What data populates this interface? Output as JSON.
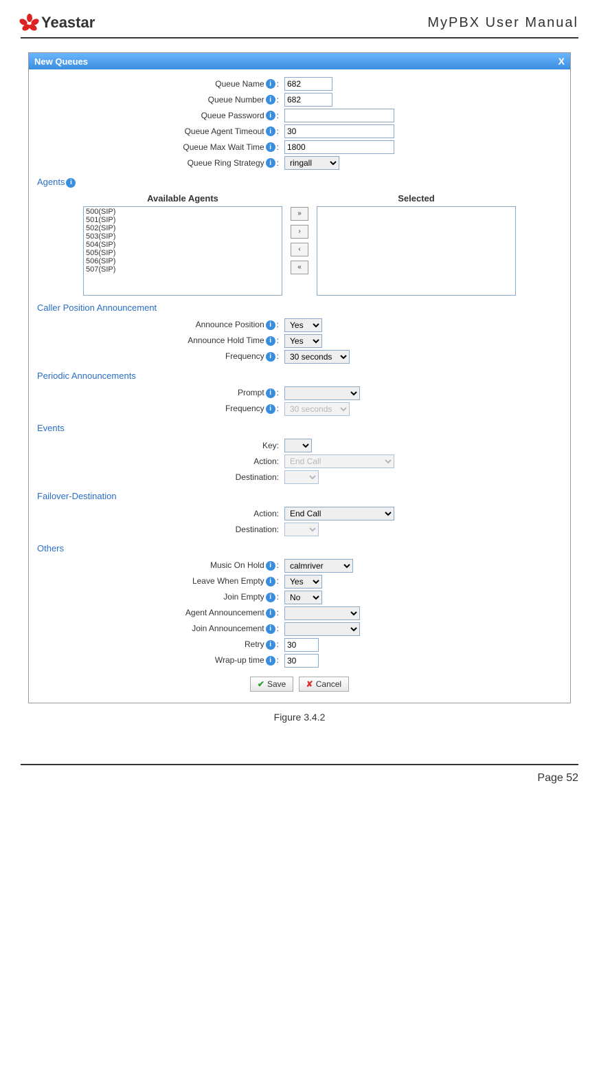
{
  "header": {
    "brand": "Yeastar",
    "doc_title": "MyPBX User Manual"
  },
  "dialog": {
    "title": "New Queues",
    "close": "X",
    "fields": {
      "queue_name": {
        "label": "Queue Name",
        "value": "682"
      },
      "queue_number": {
        "label": "Queue Number",
        "value": "682"
      },
      "queue_password": {
        "label": "Queue Password",
        "value": ""
      },
      "agent_timeout": {
        "label": "Queue Agent Timeout",
        "value": "30"
      },
      "max_wait": {
        "label": "Queue Max Wait Time",
        "value": "1800"
      },
      "ring_strategy": {
        "label": "Queue Ring Strategy",
        "value": "ringall"
      }
    },
    "agents": {
      "section": "Agents",
      "available_title": "Available Agents",
      "selected_title": "Selected",
      "available": [
        "500(SIP)",
        "501(SIP)",
        "502(SIP)",
        "503(SIP)",
        "504(SIP)",
        "505(SIP)",
        "506(SIP)",
        "507(SIP)"
      ],
      "selected": []
    },
    "caller_pos": {
      "section": "Caller Position Announcement",
      "announce_position": {
        "label": "Announce Position",
        "value": "Yes"
      },
      "announce_hold": {
        "label": "Announce Hold Time",
        "value": "Yes"
      },
      "frequency": {
        "label": "Frequency",
        "value": "30 seconds"
      }
    },
    "periodic": {
      "section": "Periodic Announcements",
      "prompt": {
        "label": "Prompt",
        "value": ""
      },
      "frequency": {
        "label": "Frequency",
        "value": "30 seconds"
      }
    },
    "events": {
      "section": "Events",
      "key": {
        "label": "Key",
        "value": ""
      },
      "action": {
        "label": "Action",
        "value": "End Call"
      },
      "destination": {
        "label": "Destination",
        "value": ""
      }
    },
    "failover": {
      "section": "Failover-Destination",
      "action": {
        "label": "Action",
        "value": "End Call"
      },
      "destination": {
        "label": "Destination",
        "value": ""
      }
    },
    "others": {
      "section": "Others",
      "music_on_hold": {
        "label": "Music On Hold",
        "value": "calmriver"
      },
      "leave_empty": {
        "label": "Leave When Empty",
        "value": "Yes"
      },
      "join_empty": {
        "label": "Join Empty",
        "value": "No"
      },
      "agent_announce": {
        "label": "Agent Announcement",
        "value": ""
      },
      "join_announce": {
        "label": "Join Announcement",
        "value": ""
      },
      "retry": {
        "label": "Retry",
        "value": "30"
      },
      "wrapup": {
        "label": "Wrap-up time",
        "value": "30"
      }
    },
    "buttons": {
      "save": "Save",
      "cancel": "Cancel"
    }
  },
  "figure_caption": "Figure 3.4.2",
  "page_number": "Page 52"
}
